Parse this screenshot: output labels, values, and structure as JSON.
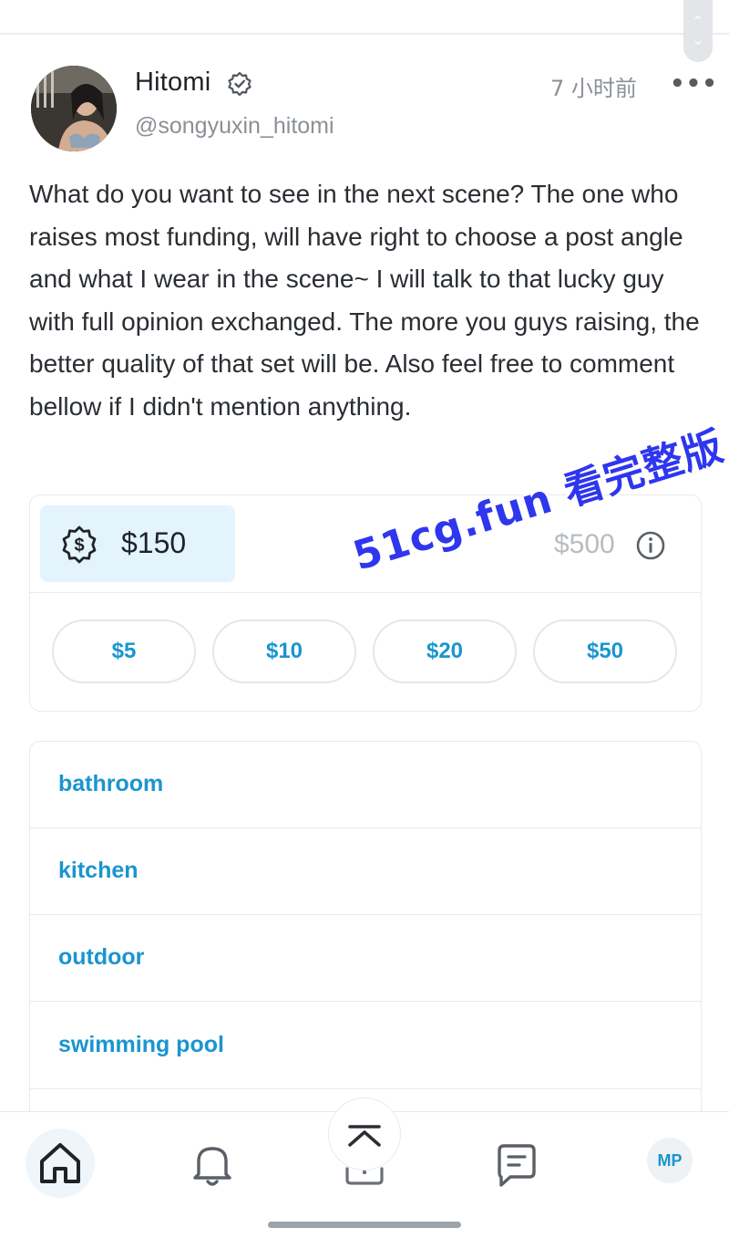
{
  "post": {
    "author_name": "Hitomi",
    "author_handle": "@songyuxin_hitomi",
    "time_ago": "7 小时前",
    "more_icon": "more-horizontal-icon",
    "verified_icon": "verified-badge-icon",
    "text": "What do you want to see in the next scene? The one who raises most funding, will have right to choose a post angle and what I wear in the scene~ I will talk to that lucky guy with full opinion exchanged. The more you guys raising, the better quality of that set will be. Also feel free to comment bellow if I didn't mention anything."
  },
  "funding": {
    "raised": "$150",
    "goal": "$500",
    "progress_fraction": 0.3,
    "icon": "funding-badge-icon",
    "info_icon": "info-icon",
    "amounts": [
      "$5",
      "$10",
      "$20",
      "$50"
    ]
  },
  "watermark": "51cg.fun 看完整版",
  "options": [
    "bathroom",
    "kitchen",
    "outdoor",
    "swimming pool"
  ],
  "nav": {
    "home_icon": "home-icon",
    "bell_icon": "bell-icon",
    "back_to_top_icon": "arrow-up-to-top-icon",
    "messages_icon": "message-icon",
    "avatar_initials": "MP"
  },
  "colors": {
    "accent": "#1a95cf",
    "raised_bg": "#e3f4fd",
    "watermark": "#2e36ee",
    "muted": "#8a9096"
  }
}
